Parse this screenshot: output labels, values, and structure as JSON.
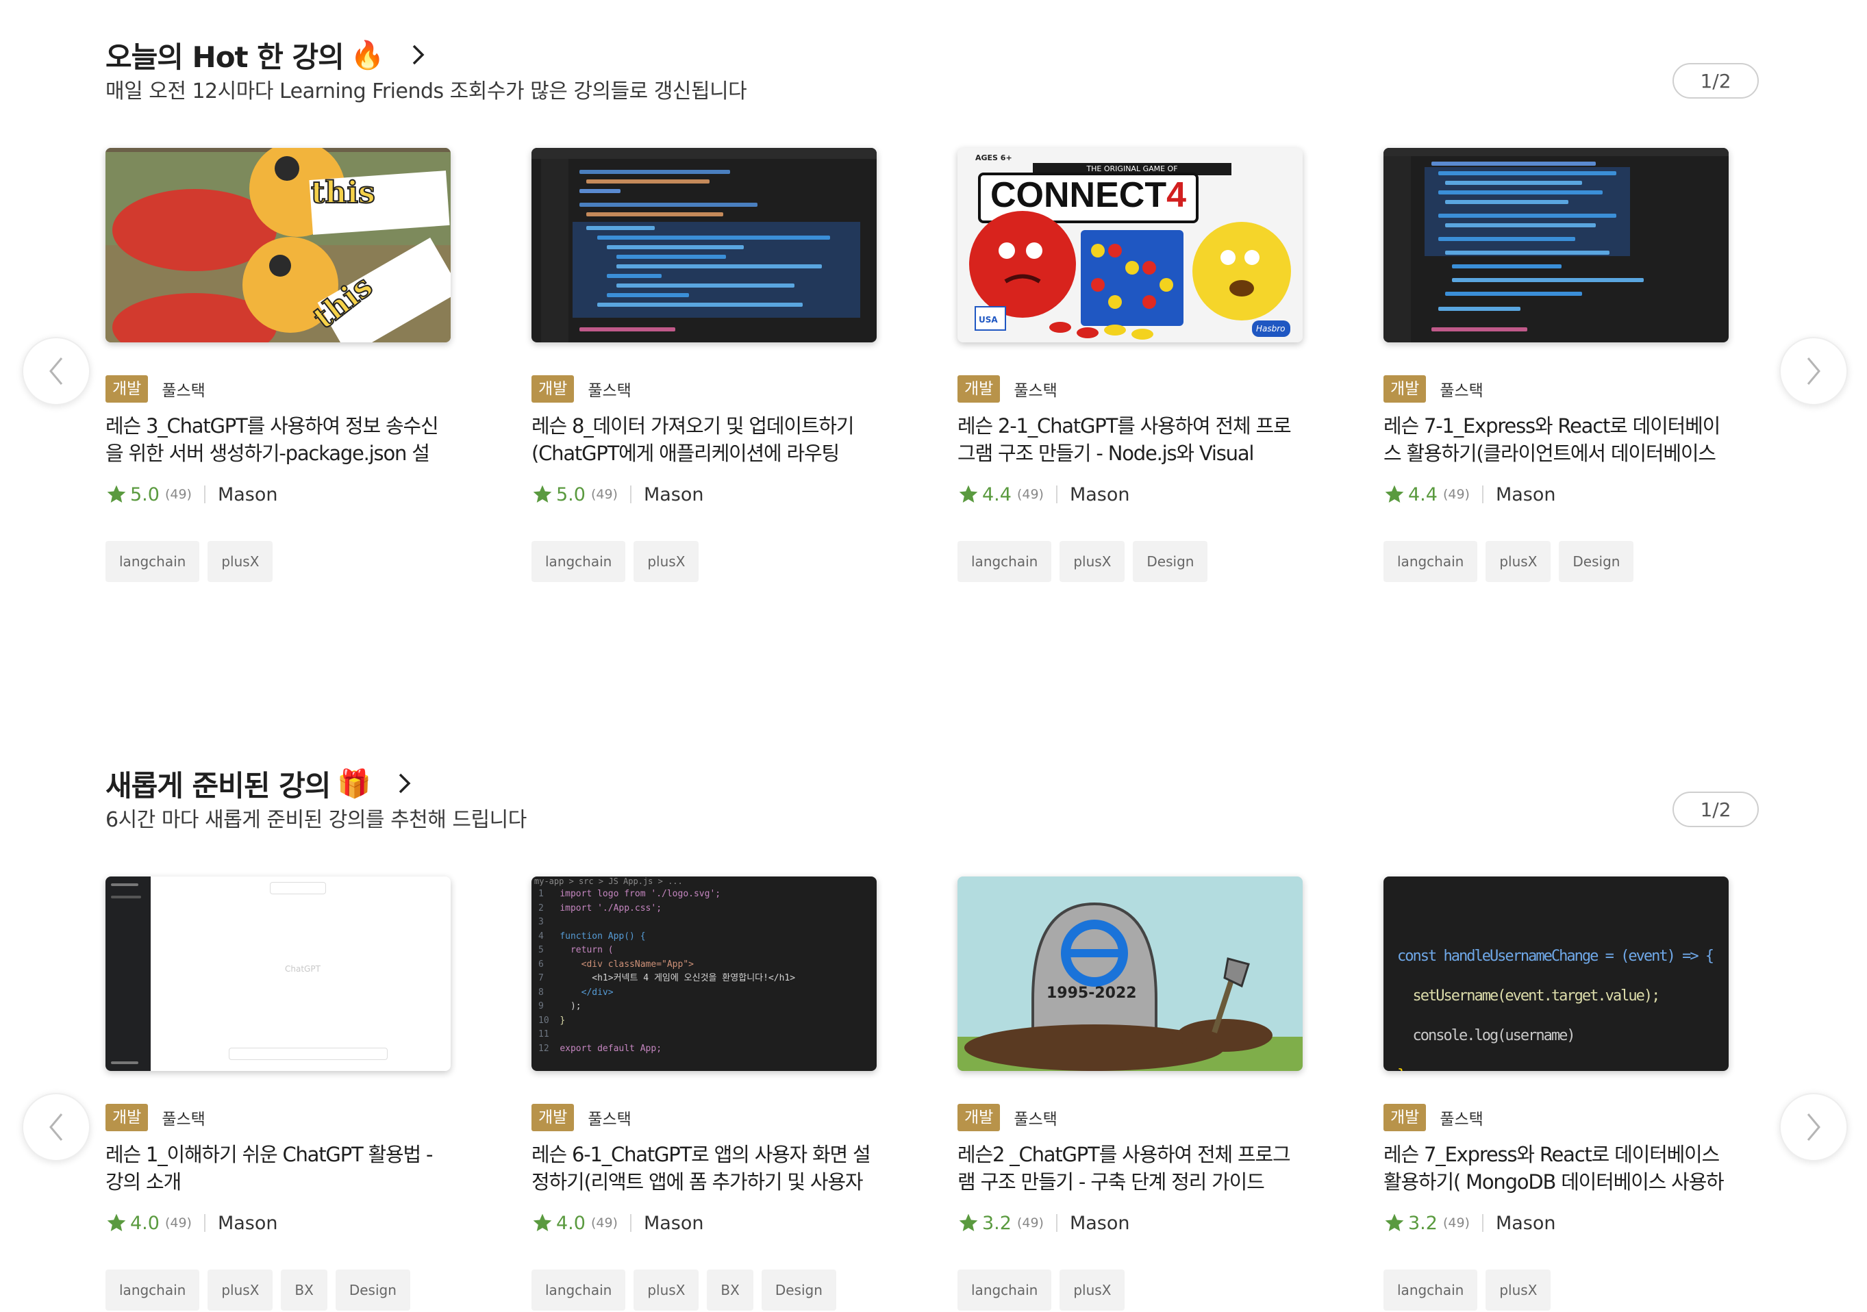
{
  "sections": [
    {
      "title": "오늘의 Hot 한 강의",
      "emoji": "🔥",
      "subtitle": "매일 오전 12시마다 Learning Friends 조회수가 많은 강의들로 갱신됩니다",
      "pager": "1/2",
      "cards": [
        {
          "badge": "개발",
          "subcategory": "풀스택",
          "title": "레슨 3_ChatGPT를 사용하여 정보 송수신을 위한 서버 생성하기-package.json 설정…",
          "rating": "5.0",
          "count": "(49)",
          "author": "Mason",
          "tags": [
            "langchain",
            "plusX"
          ],
          "thumb_text": [
            "this",
            "this"
          ]
        },
        {
          "badge": "개발",
          "subcategory": "풀스택",
          "title": "레슨 8_데이터 가져오기 및 업데이트하기 (ChatGPT에게 애플리케이션에 라우팅 기…",
          "rating": "5.0",
          "count": "(49)",
          "author": "Mason",
          "tags": [
            "langchain",
            "plusX"
          ]
        },
        {
          "badge": "개발",
          "subcategory": "풀스택",
          "title": "레슨 2-1_ChatGPT를 사용하여 전체 프로그램 구조 만들기 - Node.js와 Visual Studio Code…",
          "rating": "4.4",
          "count": "(49)",
          "author": "Mason",
          "tags": [
            "langchain",
            "plusX",
            "Design"
          ],
          "thumb_text": [
            "AGES 6+",
            "THE ORIGINAL GAME OF",
            "CONNECT",
            "4",
            "USA",
            "Hasbro"
          ]
        },
        {
          "badge": "개발",
          "subcategory": "풀스택",
          "title": "레슨 7-1_Express와 React로 데이터베이스 활용하기(클라이언트에서 데이터베이스로 요…",
          "rating": "4.4",
          "count": "(49)",
          "author": "Mason",
          "tags": [
            "langchain",
            "plusX",
            "Design"
          ]
        }
      ]
    },
    {
      "title": "새롭게 준비된 강의",
      "emoji": "🎁",
      "subtitle": "6시간 마다 새롭게 준비된 강의를 추천해 드립니다",
      "pager": "1/2",
      "cards": [
        {
          "badge": "개발",
          "subcategory": "풀스택",
          "title": "레슨 1_이해하기 쉬운 ChatGPT 활용법 - 강의 소개",
          "rating": "4.0",
          "count": "(49)",
          "author": "Mason",
          "tags": [
            "langchain",
            "plusX",
            "BX",
            "Design"
          ],
          "thumb_text": [
            "ChatGPT"
          ]
        },
        {
          "badge": "개발",
          "subcategory": "풀스택",
          "title": "레슨 6-1_ChatGPT로 앱의 사용자 화면 설정하기(리액트 앱에 폼 추가하기 및 사용자 데이…",
          "rating": "4.0",
          "count": "(49)",
          "author": "Mason",
          "tags": [
            "langchain",
            "plusX",
            "BX",
            "Design"
          ],
          "thumb_text": [
            "my-app > src > JS App.js > ...",
            "import logo from './logo.svg';",
            "import './App.css';",
            "",
            "function App() {",
            "  return (",
            "    <div className=\"App\">",
            "      <h1>커넥트 4 게임에 오신것을 환영합니다!</h1>",
            "    </div>",
            "  );",
            "}",
            "",
            "export default App;"
          ]
        },
        {
          "badge": "개발",
          "subcategory": "풀스택",
          "title": "레슨2 _ChatGPT를 사용하여 전체 프로그램 구조 만들기 - 구축 단계 정리 가이드",
          "rating": "3.2",
          "count": "(49)",
          "author": "Mason",
          "tags": [
            "langchain",
            "plusX"
          ],
          "thumb_text": [
            "1995-2022"
          ]
        },
        {
          "badge": "개발",
          "subcategory": "풀스택",
          "title": "레슨 7_Express와 React로 데이터베이스 활용하기( MongoDB 데이터베이스 사용하는 법…",
          "rating": "3.2",
          "count": "(49)",
          "author": "Mason",
          "tags": [
            "langchain",
            "plusX"
          ],
          "thumb_text": [
            "const handleUsernameChange = (event) => {",
            "  setUsername(event.target.value);",
            "  console.log(username)",
            "};"
          ]
        }
      ]
    }
  ],
  "icons": {
    "star": "star-icon",
    "prev": "chevron-left-icon",
    "next": "chevron-right-icon",
    "title_arrow": "chevron-right-icon"
  },
  "colors": {
    "badge": "#b8934a",
    "rating": "#5a9a3f",
    "code_bg": "#1e1e1e",
    "pooh_bg": "#8a7a5a"
  }
}
